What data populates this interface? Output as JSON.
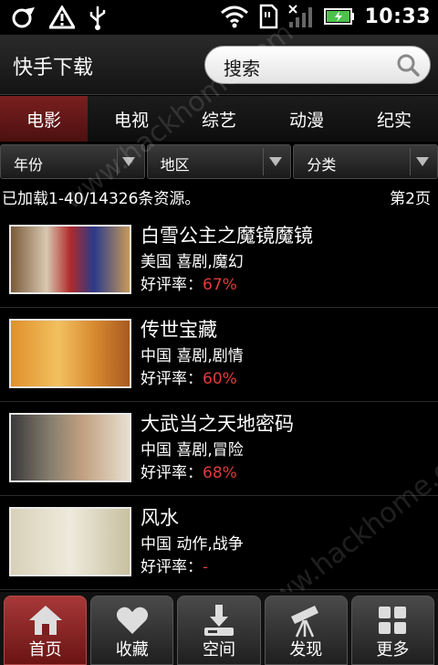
{
  "status_bar": {
    "time": "10:33",
    "icons": [
      "usb-debug-icon",
      "warning-icon",
      "usb-icon",
      "wifi-icon",
      "sd-card-icon",
      "signal-icon",
      "battery-icon"
    ]
  },
  "header": {
    "title": "快手下载",
    "search_placeholder": "搜索"
  },
  "tabs": [
    {
      "label": "电影",
      "active": true
    },
    {
      "label": "电视",
      "active": false
    },
    {
      "label": "综艺",
      "active": false
    },
    {
      "label": "动漫",
      "active": false
    },
    {
      "label": "纪实",
      "active": false
    }
  ],
  "filters": [
    {
      "label": "年份"
    },
    {
      "label": "地区"
    },
    {
      "label": "分类"
    }
  ],
  "info": {
    "loaded": "已加载1-40/14326条资源。",
    "page": "第2页"
  },
  "items": [
    {
      "title": "白雪公主之魔镜魔镜",
      "meta": "美国  喜剧,魔幻",
      "rating_label": "好评率：",
      "rating_value": "67%"
    },
    {
      "title": "传世宝藏",
      "meta": "中国  喜剧,剧情",
      "rating_label": "好评率：",
      "rating_value": "60%"
    },
    {
      "title": "大武当之天地密码",
      "meta": "中国  喜剧,冒险",
      "rating_label": "好评率：",
      "rating_value": "68%"
    },
    {
      "title": "风水",
      "meta": "中国  动作,战争",
      "rating_label": "好评率：",
      "rating_value": "-"
    }
  ],
  "bottom_nav": [
    {
      "label": "首页",
      "icon": "home-icon",
      "active": true
    },
    {
      "label": "收藏",
      "icon": "heart-icon",
      "active": false
    },
    {
      "label": "空间",
      "icon": "download-icon",
      "active": false
    },
    {
      "label": "发现",
      "icon": "telescope-icon",
      "active": false
    },
    {
      "label": "更多",
      "icon": "grid-icon",
      "active": false
    }
  ],
  "watermark": "www.hackhome.com",
  "colors": {
    "accent": "#7a1f1f",
    "rating": "#e23b3b"
  }
}
